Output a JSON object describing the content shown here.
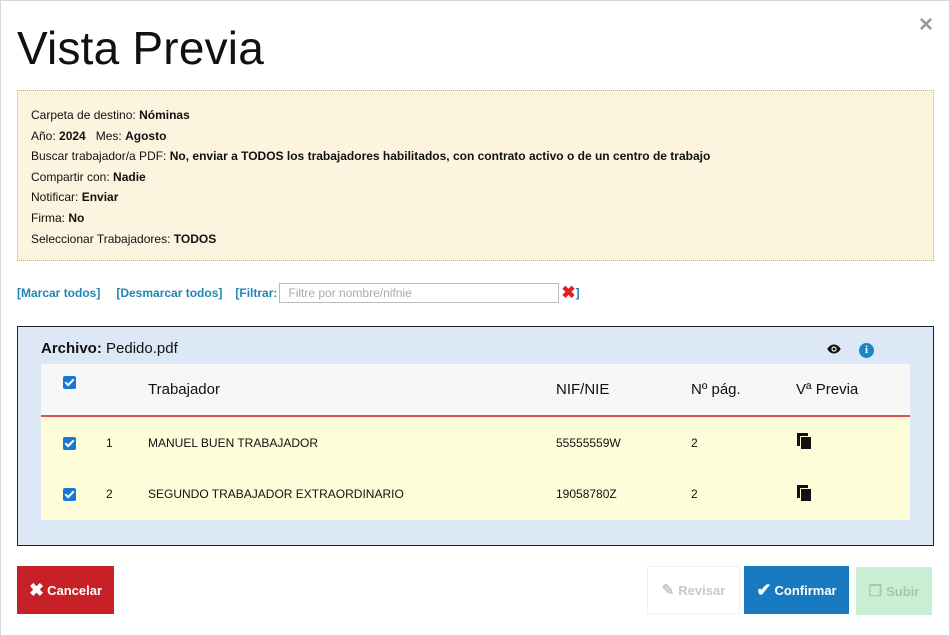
{
  "dialog": {
    "title": "Vista Previa",
    "close_glyph": "×"
  },
  "summary": {
    "folder_label": "Carpeta de destino:",
    "folder_value": "Nóminas",
    "year_label": "Año:",
    "year_value": "2024",
    "month_label": "Mes:",
    "month_value": "Agosto",
    "search_label": "Buscar trabajador/a PDF:",
    "search_value": "No, enviar a TODOS los trabajadores habilitados, con contrato activo o de un centro de trabajo",
    "share_label": "Compartir con:",
    "share_value": "Nadie",
    "notify_label": "Notificar:",
    "notify_value": "Enviar",
    "sign_label": "Firma:",
    "sign_value": "No",
    "select_label": "Seleccionar Trabajadores:",
    "select_value": "TODOS"
  },
  "selection": {
    "mark_all": "[Marcar todos]",
    "unmark_all": "[Desmarcar todos]",
    "filter_open": "[Filtrar:",
    "filter_placeholder": "Filtre por nombre/nifnie",
    "filter_close": "]"
  },
  "file": {
    "label": "Archivo:",
    "name": "Pedido.pdf",
    "icons": [
      "eye-icon",
      "info-icon"
    ]
  },
  "table": {
    "headers": {
      "worker": "Trabajador",
      "nif": "NIF/NIE",
      "pages": "Nº pág.",
      "preview": "Vª Previa"
    },
    "rows": [
      {
        "num": "1",
        "name": "MANUEL BUEN TRABAJADOR",
        "nif": "55555559W",
        "pages": "2",
        "checked": true
      },
      {
        "num": "2",
        "name": "SEGUNDO TRABAJADOR EXTRAORDINARIO",
        "nif": "19058780Z",
        "pages": "2",
        "checked": true
      }
    ]
  },
  "buttons": {
    "cancel": "Cancelar",
    "review": "Revisar",
    "confirm": "Confirmar",
    "upload": "Subir"
  },
  "colors": {
    "cancel": "#c72127",
    "confirm": "#1779bf",
    "upload_disabled": "#c9eed3",
    "summary_bg": "#fcf4de",
    "panel_bg": "#dde8f6",
    "row_bg": "#fdfdd9",
    "link": "#1f86b4",
    "header_divider": "#d9534f"
  }
}
